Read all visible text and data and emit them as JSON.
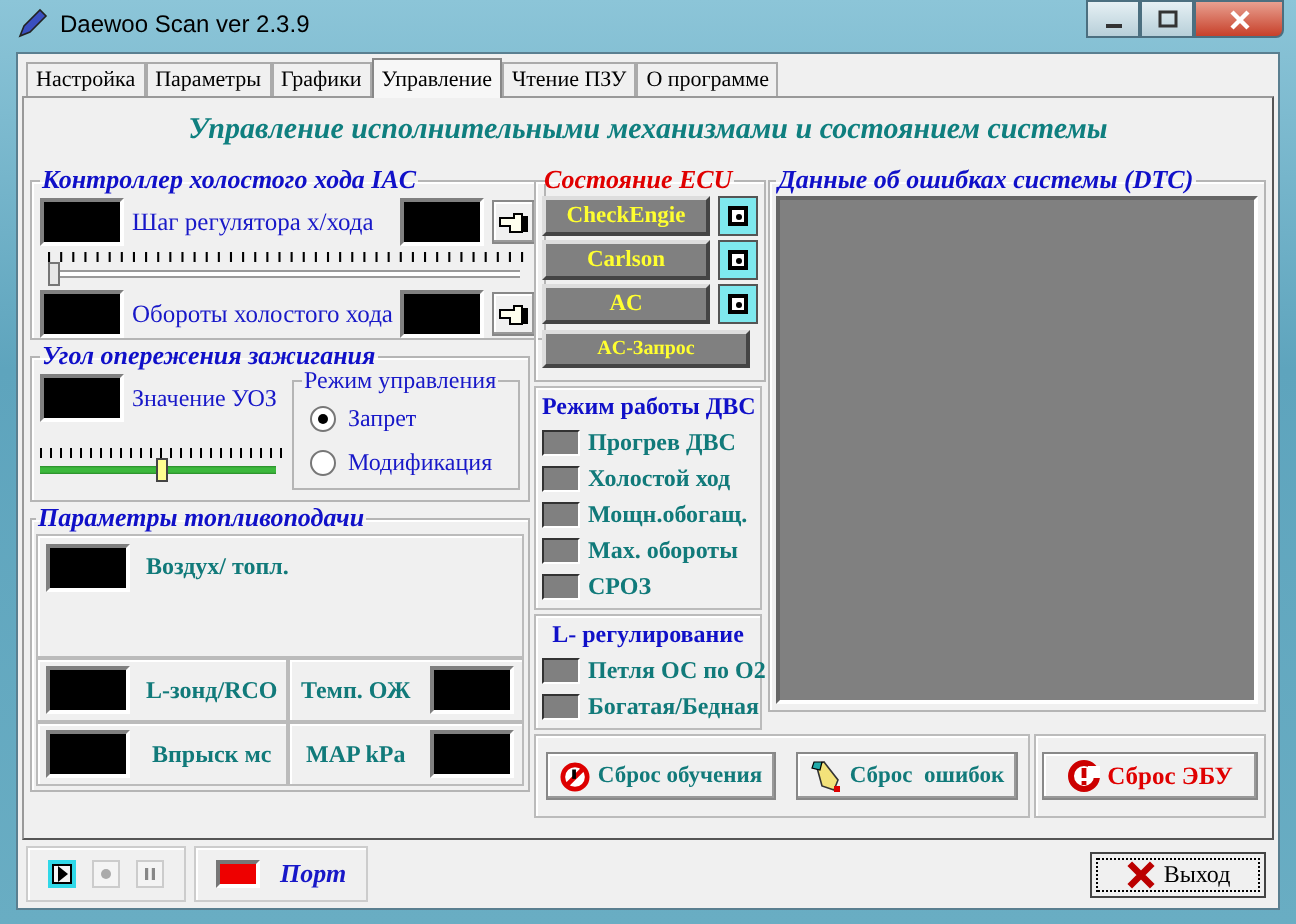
{
  "window": {
    "title": "Daewoo Scan ver 2.3.9"
  },
  "tabs": [
    {
      "label": "Настройка",
      "selected": false
    },
    {
      "label": "Параметры",
      "selected": false
    },
    {
      "label": "Графики",
      "selected": false
    },
    {
      "label": "Управление",
      "selected": true
    },
    {
      "label": "Чтение ПЗУ",
      "selected": false
    },
    {
      "label": "О программе",
      "selected": false
    }
  ],
  "heading": "Управление исполнительными механизмами и состоянием системы",
  "iac": {
    "title": "Контроллер холостого хода IAC",
    "step_label": "Шаг регулятора х/хода",
    "slider": {
      "level": 0
    },
    "rpm_label": "Обороты холостого хода"
  },
  "ignition": {
    "title": "Угол опережения зажигания",
    "value_label": "Значение УОЗ",
    "slider": {
      "level": 0.49
    },
    "mode": {
      "title": "Режим управления",
      "options": [
        {
          "label": "Запрет",
          "selected": true
        },
        {
          "label": "Модификация",
          "selected": false
        }
      ]
    }
  },
  "fuel": {
    "title": "Параметры топливоподачи",
    "air_label": "Воздух/ топл.",
    "cells": [
      {
        "label": "L-зонд/RCO",
        "kind": "leading"
      },
      {
        "label": "Темп. ОЖ",
        "kind": "trailing"
      },
      {
        "label": "Впрыск мс",
        "kind": "leading"
      },
      {
        "label": "MAP kPa",
        "kind": "trailing"
      }
    ]
  },
  "ecu": {
    "title": "Состояние ECU",
    "buttons": [
      {
        "label": "CheckEngie",
        "kind": "toggle"
      },
      {
        "label": "Carlson",
        "kind": "toggle"
      },
      {
        "label": "AC",
        "kind": "toggle"
      },
      {
        "label": "AC-Запрос",
        "kind": "plain"
      }
    ]
  },
  "engine_mode": {
    "title": "Режим работы ДВС",
    "flags": [
      {
        "label": "Прогрев ДВС",
        "on": false
      },
      {
        "label": "Холостой ход",
        "on": false
      },
      {
        "label": "Мощн.обогащ.",
        "on": false
      },
      {
        "label": "Max. обороты",
        "on": false
      },
      {
        "label": "СРОЗ",
        "on": false
      }
    ]
  },
  "lambda": {
    "title": "L- регулирование",
    "flags": [
      {
        "label": "Петля ОС по О2",
        "on": false
      },
      {
        "label": "Богатая/Бедная",
        "on": false
      }
    ]
  },
  "dtc": {
    "title": "Данные об ошибках системы (DTC)"
  },
  "actions": [
    {
      "label": "Сброс обучения",
      "kind": "normal"
    },
    {
      "label": "Сброс  ошибок",
      "kind": "normal"
    },
    {
      "label": "Сброс ЭБУ",
      "kind": "danger"
    }
  ],
  "player": [
    {
      "selected": true,
      "disabled": false
    },
    {
      "selected": false,
      "disabled": true
    },
    {
      "selected": false,
      "disabled": true
    }
  ],
  "port": {
    "label": "Порт",
    "connected": false
  },
  "exit_button": "Выход"
}
